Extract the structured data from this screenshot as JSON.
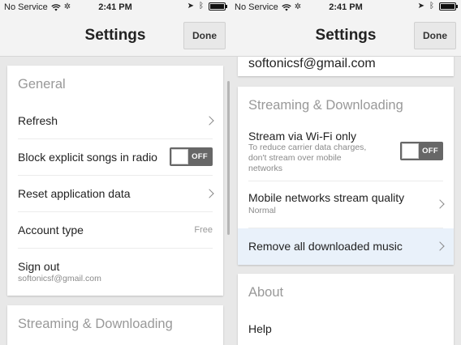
{
  "status_bar": {
    "carrier": "No Service",
    "time": "2:41 PM"
  },
  "nav": {
    "title": "Settings",
    "done_label": "Done"
  },
  "left_screen": {
    "general": {
      "title": "General",
      "refresh_label": "Refresh",
      "block_explicit_label": "Block explicit songs in radio",
      "block_explicit_state": "OFF",
      "reset_label": "Reset application data",
      "account_type_label": "Account type",
      "account_type_value": "Free",
      "sign_out_label": "Sign out",
      "sign_out_email": "softonicsf@gmail.com"
    },
    "streaming": {
      "title": "Streaming & Downloading"
    }
  },
  "right_screen": {
    "account_email": "softonicsf@gmail.com",
    "streaming": {
      "title": "Streaming & Downloading",
      "wifi_label": "Stream via Wi-Fi only",
      "wifi_sub_1": "To reduce carrier data charges,",
      "wifi_sub_2": "don't stream over mobile",
      "wifi_sub_3": "networks",
      "wifi_state": "OFF",
      "quality_label": "Mobile networks stream quality",
      "quality_value": "Normal",
      "remove_label": "Remove all downloaded music"
    },
    "about": {
      "title": "About",
      "help_label": "Help"
    }
  }
}
